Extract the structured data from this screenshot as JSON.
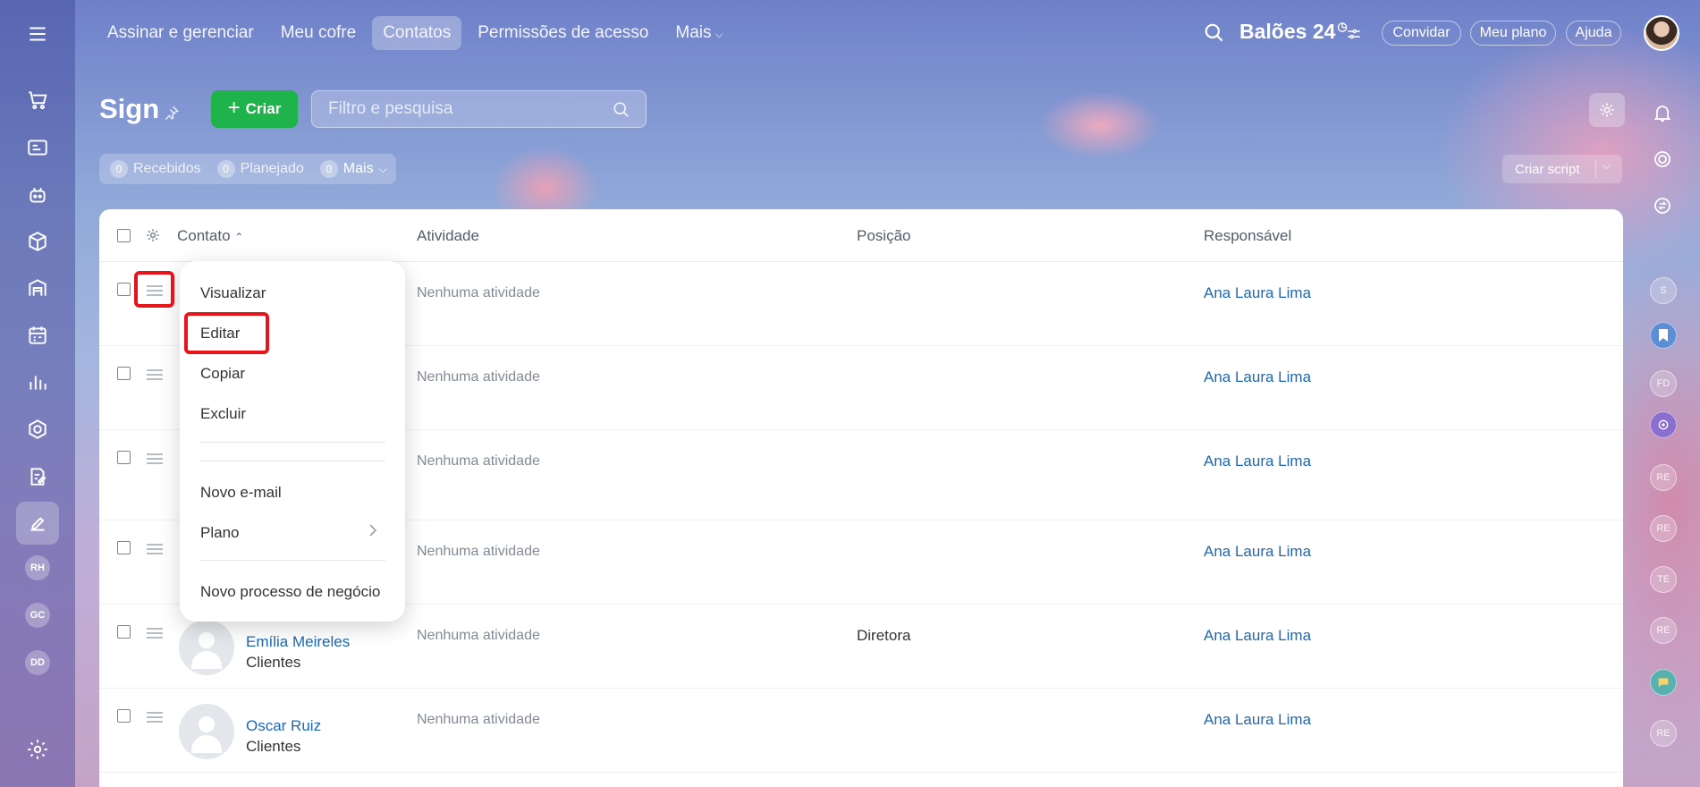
{
  "topnav": {
    "items": [
      {
        "label": "Assinar e gerenciar",
        "active": false
      },
      {
        "label": "Meu cofre",
        "active": false
      },
      {
        "label": "Contatos",
        "active": true
      },
      {
        "label": "Permissões de acesso",
        "active": false
      }
    ],
    "more_label": "Mais"
  },
  "brand": {
    "name": "Balões 24"
  },
  "top_actions": {
    "invite": "Convidar",
    "plan": "Meu plano",
    "help": "Ajuda"
  },
  "sidebar": {
    "avatars": [
      "RH",
      "GC",
      "DD"
    ]
  },
  "page": {
    "title": "Sign"
  },
  "toolbar": {
    "create_label": "Criar",
    "filter_placeholder": "Filtro e pesquisa",
    "script_label": "Criar script"
  },
  "counters": [
    {
      "count": "0",
      "label": "Recebidos"
    },
    {
      "count": "0",
      "label": "Planejado"
    },
    {
      "count": "0",
      "label": "Mais"
    }
  ],
  "table": {
    "columns": {
      "contact": "Contato",
      "activity": "Atividade",
      "position": "Posição",
      "responsible": "Responsável"
    },
    "rows": [
      {
        "name": "",
        "type": "",
        "activity": "Nenhuma atividade",
        "position": "",
        "responsible": "Ana Laura Lima"
      },
      {
        "name": "",
        "type": "",
        "activity": "Nenhuma atividade",
        "position": "",
        "responsible": "Ana Laura Lima"
      },
      {
        "name": "",
        "type": "",
        "activity": "Nenhuma atividade",
        "position": "",
        "responsible": "Ana Laura Lima"
      },
      {
        "name": "",
        "type": "",
        "activity": "Nenhuma atividade",
        "position": "",
        "responsible": "Ana Laura Lima"
      },
      {
        "name": "Emília Meireles",
        "type": "Clientes",
        "activity": "Nenhuma atividade",
        "position": "Diretora",
        "responsible": "Ana Laura Lima"
      },
      {
        "name": "Oscar Ruiz",
        "type": "Clientes",
        "activity": "Nenhuma atividade",
        "position": "",
        "responsible": "Ana Laura Lima"
      }
    ]
  },
  "context_menu": {
    "items": [
      "Visualizar",
      "Editar",
      "Copiar",
      "Excluir",
      "Novo e-mail",
      "Plano",
      "Novo processo de negócio"
    ]
  },
  "right_rail": {
    "avatars": [
      "S",
      "FD",
      "RE",
      "RE",
      "TE",
      "RE",
      "RE"
    ]
  },
  "colors": {
    "accent_green": "#1fb34b",
    "link_blue": "#2067b0",
    "highlight_red": "#e8141c"
  }
}
